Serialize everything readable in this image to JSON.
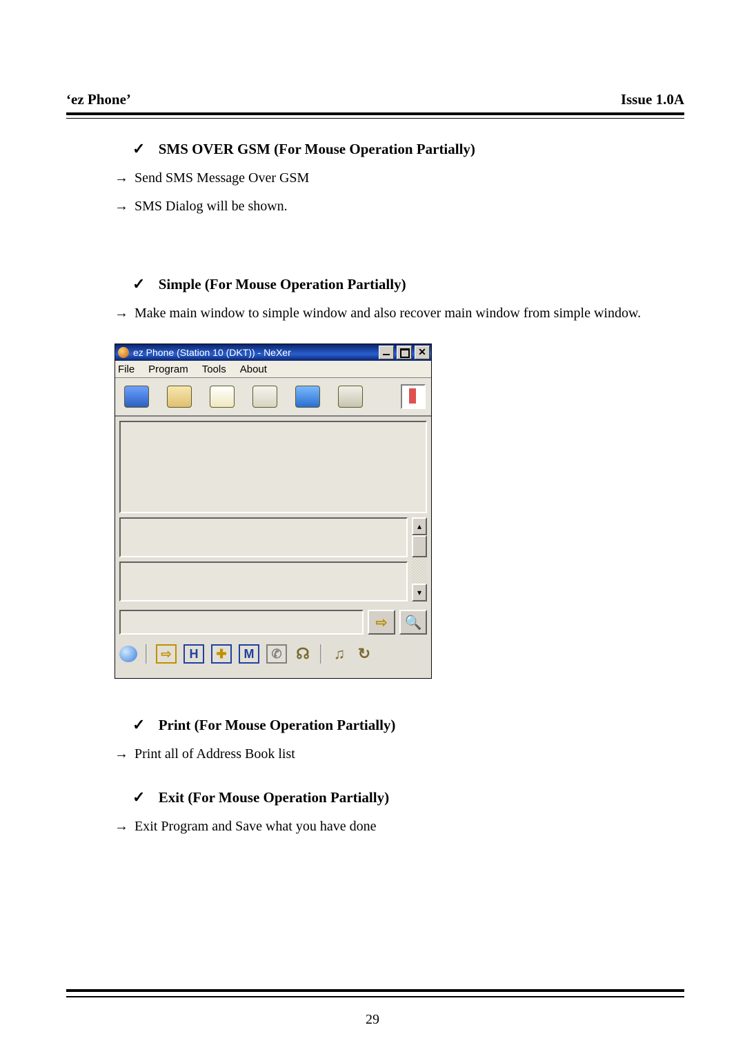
{
  "page_number": "29",
  "header": {
    "left": "‘ez Phone’",
    "right": "Issue 1.0A"
  },
  "glyphs": {
    "check": "✓",
    "arrow": "→"
  },
  "sec_sms": {
    "title": "SMS OVER GSM (For Mouse Operation Partially)",
    "l1": "Send SMS Message Over GSM",
    "l2": "SMS Dialog will be shown."
  },
  "sec_simple": {
    "title": "Simple (For Mouse Operation Partially)",
    "l1": "Make main window to simple window and also recover main window from simple window."
  },
  "sec_print": {
    "title": "Print (For Mouse Operation Partially)",
    "l1": "Print all of Address Book list"
  },
  "sec_exit": {
    "title": "Exit (For Mouse Operation Partially)",
    "l1": "Exit Program and Save what you have done"
  },
  "app": {
    "title": "ez Phone (Station 10 (DKT)) - NeXer",
    "menus": {
      "file": "File",
      "program": "Program",
      "tools": "Tools",
      "about": "About"
    },
    "toolbar_icons": [
      "monitor",
      "document",
      "mail",
      "send",
      "home",
      "print"
    ],
    "bottom_icons": [
      "globe",
      "arrow",
      "hold",
      "transfer",
      "memo",
      "phone",
      "headset",
      "loop",
      "bell"
    ],
    "scroll_up": "▴",
    "scroll_down": "▾",
    "go_glyph": "⇨",
    "search_glyph": "🔍"
  }
}
